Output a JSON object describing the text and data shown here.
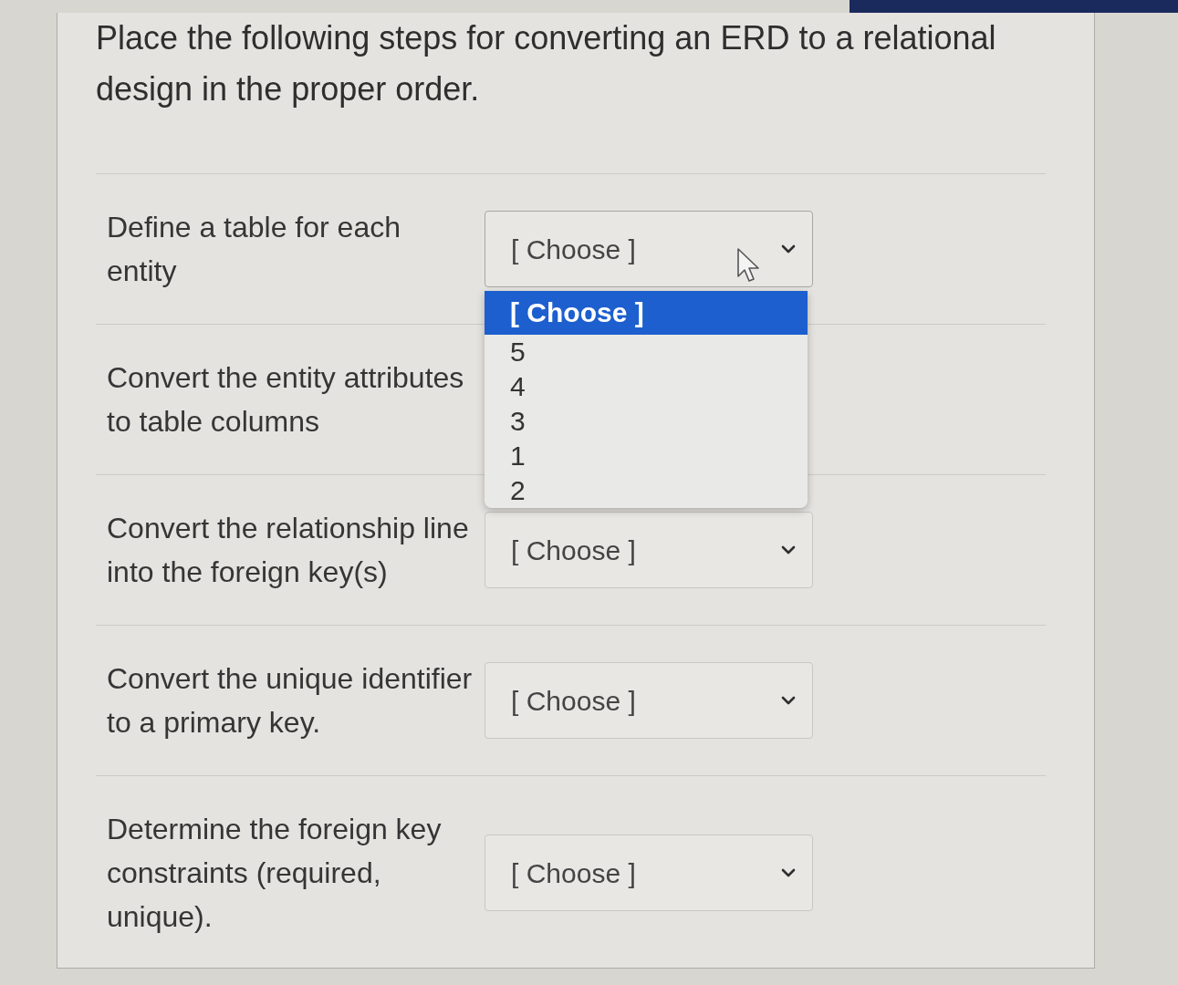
{
  "question": {
    "text": "Place the following steps for converting an ERD to a relational design in the proper order."
  },
  "matches": [
    {
      "prompt": "Define a table for each entity",
      "value": "[ Choose ]",
      "expanded": true,
      "options": [
        {
          "label": "[ Choose ]",
          "selected": true
        },
        {
          "label": "5",
          "selected": false
        },
        {
          "label": "4",
          "selected": false
        },
        {
          "label": "3",
          "selected": false
        },
        {
          "label": "1",
          "selected": false
        },
        {
          "label": "2",
          "selected": false
        }
      ]
    },
    {
      "prompt": "Convert the entity attributes to table columns"
    },
    {
      "prompt": "Convert the relationship line into the foreign key(s)",
      "value": "[ Choose ]",
      "expanded": false
    },
    {
      "prompt": "Convert the unique identifier to a primary key.",
      "value": "[ Choose ]",
      "expanded": false
    },
    {
      "prompt": "Determine the foreign key constraints (required, unique).",
      "value": "[ Choose ]",
      "expanded": false
    }
  ]
}
